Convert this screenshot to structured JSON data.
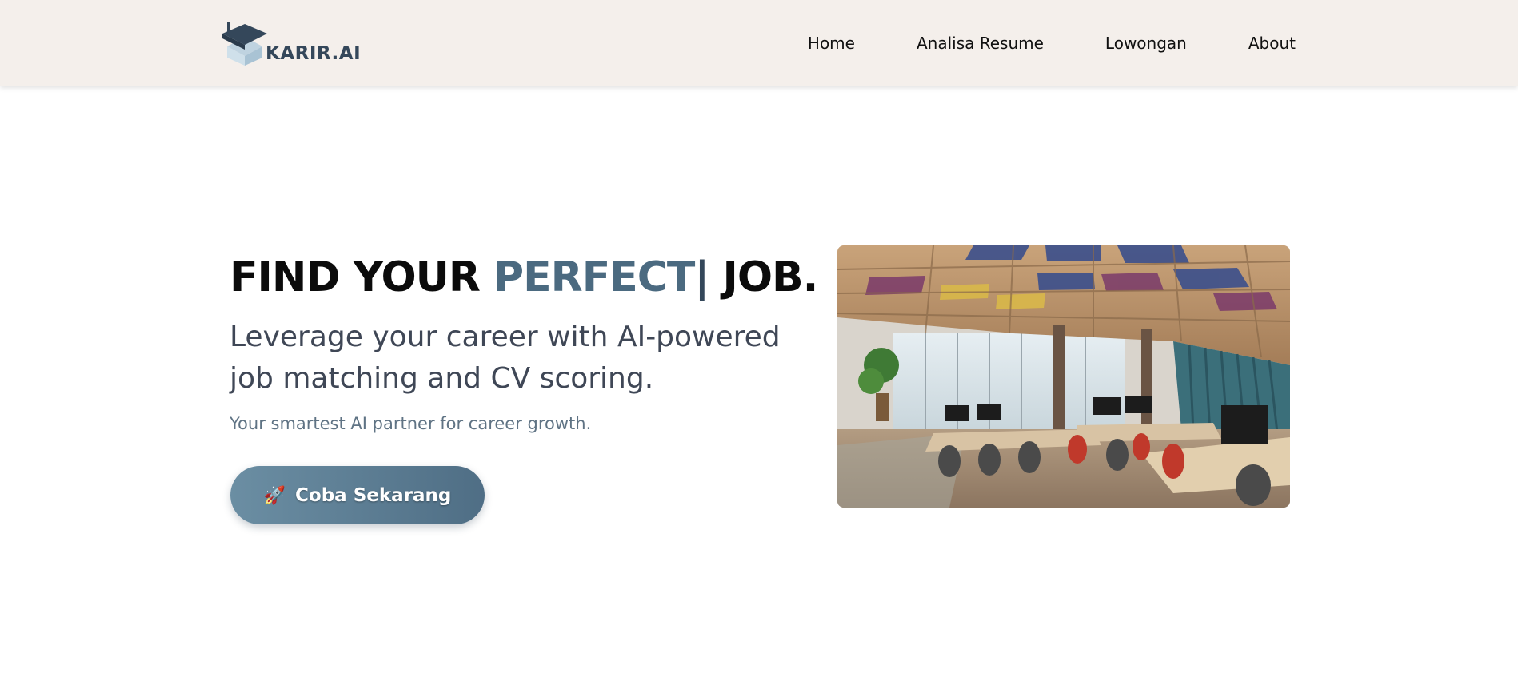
{
  "brand": {
    "logo_text": "KARIR.AI",
    "logo_icon": "graduation-cap-icon",
    "color_dark": "#34475a",
    "color_light": "#bfd3e0"
  },
  "nav": {
    "items": [
      "Home",
      "Analisa Resume",
      "Lowongan",
      "About"
    ]
  },
  "hero": {
    "title_part1": "FIND YOUR ",
    "title_accent": "PERFECT",
    "title_cursor": "|",
    "title_part2": " JOB.",
    "subtitle": "Leverage your career with AI-powered job matching and CV scoring.",
    "tagline": "Your smartest AI partner for career growth.",
    "cta_icon": "🚀",
    "cta_label": "Coba Sekarang",
    "accent_color": "#4b6a80"
  },
  "colors": {
    "header_bg": "#f4efeb",
    "cta_start": "#6b8ea3",
    "cta_end": "#4f6e85"
  }
}
